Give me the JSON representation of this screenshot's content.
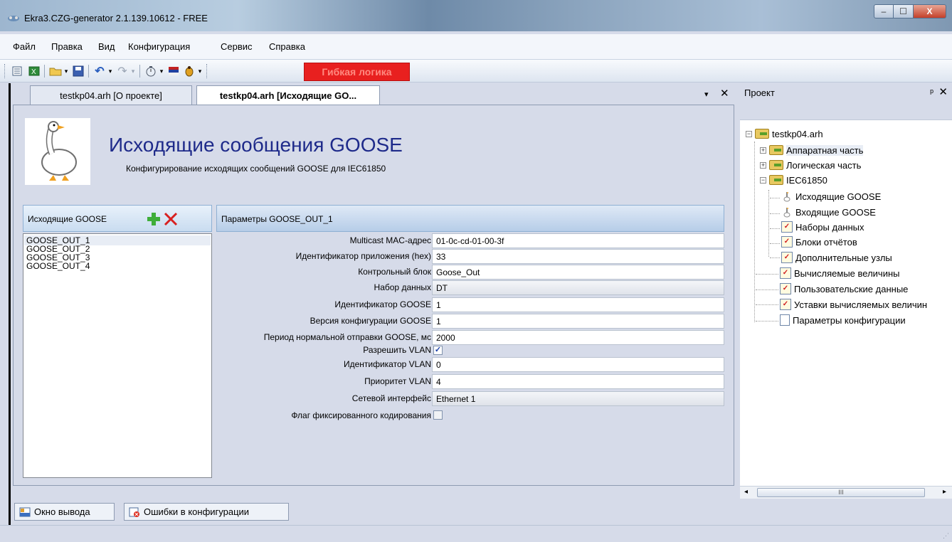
{
  "window": {
    "title": "Ekra3.CZG-generator 2.1.139.10612 - FREE",
    "minimize": "‒",
    "maximize": "☐",
    "close": "X"
  },
  "menu": [
    "Файл",
    "Правка",
    "Вид",
    "Конфигурация",
    "Сервис",
    "Справка"
  ],
  "toolbar": {
    "logic_button": "Гибкая логика"
  },
  "tabs": {
    "inactive": "testkp04.arh [О проекте]",
    "active": "testkp04.arh [Исходящие GO...",
    "menu_glyph": "▾",
    "close_glyph": "✕"
  },
  "header": {
    "title": "Исходящие сообщения GOOSE",
    "subtitle": "Конфигурирование исходящих сообщений GOOSE для IEC61850"
  },
  "left_panel": {
    "title": "Исходящие GOOSE",
    "items": [
      "GOOSE_OUT_1",
      "GOOSE_OUT_2",
      "GOOSE_OUT_3",
      "GOOSE_OUT_4"
    ]
  },
  "params": {
    "title": "Параметры GOOSE_OUT_1",
    "rows": [
      {
        "label": "Multicast MAC-адрес",
        "value": "01-0c-cd-01-00-3f"
      },
      {
        "label": "Идентификатор приложения (hex)",
        "value": "33"
      },
      {
        "label": "Контрольный блок",
        "value": "Goose_Out"
      },
      {
        "label": "Набор данных",
        "value": "DT"
      },
      {
        "label": "Идентификатор GOOSE",
        "value": "1"
      },
      {
        "label": "Версия конфигурации GOOSE",
        "value": "1"
      },
      {
        "label": "Период нормальной отправки GOOSE, мс",
        "value": "2000"
      },
      {
        "label": "Разрешить VLAN",
        "checked": true
      },
      {
        "label": "Идентификатор VLAN",
        "value": "0"
      },
      {
        "label": "Приоритет VLAN",
        "value": "4"
      },
      {
        "label": "Сетевой интерфейс",
        "value": "Ethernet 1"
      },
      {
        "label": "Флаг фиксированного кодирования",
        "checked": false
      }
    ]
  },
  "project": {
    "title": "Проект",
    "pin": "ᵖ",
    "close": "✕",
    "tree": {
      "root": "testkp04.arh",
      "hardware": "Аппаратная часть",
      "logic": "Логическая часть",
      "iec": "IEC61850",
      "out_goose": "Исходящие GOOSE",
      "in_goose": "Входящие GOOSE",
      "datasets": "Наборы данных",
      "reports": "Блоки отчётов",
      "extra_nodes": "Дополнительные узлы",
      "calc_values": "Вычисляемые величины",
      "user_data": "Пользовательские данные",
      "calc_settings": "Уставки вычисляемых величин",
      "config_params": "Параметры конфигурации"
    },
    "scroll_thumb": "III"
  },
  "bottom_tabs": {
    "output": "Окно вывода",
    "errors": "Ошибки в конфигурации"
  },
  "colors": {
    "header_title": "#1e2a8a",
    "logic_button_bg": "#e8201f",
    "window_bg": "#d6dbe9"
  }
}
